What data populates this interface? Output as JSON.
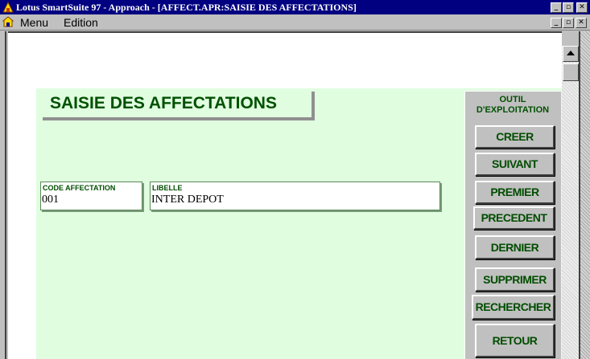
{
  "window": {
    "title": "Lotus SmartSuite 97   - Approach - [AFFECT.APR:SAISIE DES AFFECTATIONS]",
    "minimize": "_",
    "maximize": "▫",
    "close": "✕"
  },
  "menubar": {
    "items": [
      "Menu",
      "Edition"
    ]
  },
  "form": {
    "title": "SAISIE DES AFFECTATIONS",
    "fields": [
      {
        "label": "CODE AFFECTATION",
        "value": "001"
      },
      {
        "label": "LIBELLE",
        "value": "INTER DEPOT"
      }
    ]
  },
  "tools": {
    "title_line1": "OUTIL",
    "title_line2": "D'EXPLOITATION",
    "buttons": [
      "CREER",
      "SUIVANT",
      "PREMIER",
      "PRECEDENT",
      "DERNIER",
      "SUPPRIMER",
      "RECHERCHER",
      "RETOUR"
    ]
  },
  "colors": {
    "titlebar": "#000080",
    "form_bg": "#e0fde0",
    "label_green": "#004d00"
  },
  "icons": [
    "app-icon",
    "document-icon",
    "scroll-up-arrow-icon"
  ]
}
